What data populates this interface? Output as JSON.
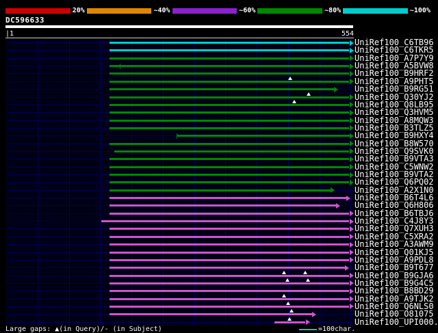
{
  "colors": {
    "cyan": "#00cccc",
    "green": "#008800",
    "magenta": "#cc55cc",
    "background": "#000000",
    "plot_background": "#000016",
    "grid": "#000066",
    "gap_marker": "#ffffff"
  },
  "query": {
    "id": "DC596633",
    "start_label": "|1",
    "end_label": "554",
    "length": 554
  },
  "legend": {
    "gaps_text": "Large gaps: ▲(in Query)/- (in Subject)",
    "scale_text": "=100char."
  },
  "chart_data": {
    "type": "bar",
    "orientation": "horizontal",
    "title": "DC596633",
    "x_range": [
      1,
      554
    ],
    "grid_interval": 50,
    "identity_key": [
      {
        "color": "#cc0000",
        "label": "20%"
      },
      {
        "color": "#dd8800",
        "label": "~40%"
      },
      {
        "color": "#8822cc",
        "label": "~60%"
      },
      {
        "color": "#008800",
        "label": "~80%"
      },
      {
        "color": "#00cccc",
        "label": "~100%"
      }
    ],
    "rows": [
      {
        "label": "UniRef100_C6TB96",
        "color": "cyan",
        "start": 165,
        "end": 548,
        "gaps": [],
        "ticks": []
      },
      {
        "label": "UniRef100_C6TKR5",
        "color": "cyan",
        "start": 165,
        "end": 548,
        "gaps": [],
        "ticks": []
      },
      {
        "label": "UniRef100_A7P7Y9",
        "color": "green",
        "start": 165,
        "end": 548,
        "gaps": [],
        "ticks": []
      },
      {
        "label": "UniRef100_A5BVW8",
        "color": "green",
        "start": 165,
        "end": 548,
        "gaps": [],
        "ticks": [
          181
        ]
      },
      {
        "label": "UniRef100_B9HRF2",
        "color": "green",
        "start": 165,
        "end": 548,
        "gaps": [],
        "ticks": []
      },
      {
        "label": "UniRef100_A9PHT5",
        "color": "green",
        "start": 165,
        "end": 548,
        "gaps": [
          453
        ],
        "ticks": []
      },
      {
        "label": "UniRef100_B9RG51",
        "color": "green",
        "start": 165,
        "end": 523,
        "gaps": [],
        "ticks": []
      },
      {
        "label": "UniRef100_Q30YJ2",
        "color": "green",
        "start": 165,
        "end": 548,
        "gaps": [
          483
        ],
        "ticks": []
      },
      {
        "label": "UniRef100_Q8LB95",
        "color": "green",
        "start": 165,
        "end": 548,
        "gaps": [
          460
        ],
        "ticks": []
      },
      {
        "label": "UniRef100_Q3HVM5",
        "color": "green",
        "start": 165,
        "end": 548,
        "gaps": [],
        "ticks": []
      },
      {
        "label": "UniRef100_A8MQW3",
        "color": "green",
        "start": 165,
        "end": 548,
        "gaps": [],
        "ticks": []
      },
      {
        "label": "UniRef100_B3TLZ5",
        "color": "green",
        "start": 165,
        "end": 548,
        "gaps": [],
        "ticks": []
      },
      {
        "label": "UniRef100_B9HXY4",
        "color": "green",
        "start": 272,
        "end": 548,
        "gaps": [],
        "ticks": [
          272
        ]
      },
      {
        "label": "UniRef100_B8W570",
        "color": "green",
        "start": 165,
        "end": 548,
        "gaps": [],
        "ticks": []
      },
      {
        "label": "UniRef100_Q9SVK0",
        "color": "green",
        "start": 173,
        "end": 548,
        "gaps": [],
        "ticks": []
      },
      {
        "label": "UniRef100_B9VTA3",
        "color": "green",
        "start": 165,
        "end": 548,
        "gaps": [],
        "ticks": []
      },
      {
        "label": "UniRef100_C5WNW2",
        "color": "green",
        "start": 165,
        "end": 548,
        "gaps": [],
        "ticks": []
      },
      {
        "label": "UniRef100_B9VTA2",
        "color": "green",
        "start": 165,
        "end": 548,
        "gaps": [],
        "ticks": []
      },
      {
        "label": "UniRef100_Q6PQ02",
        "color": "green",
        "start": 165,
        "end": 548,
        "gaps": [],
        "ticks": []
      },
      {
        "label": "UniRef100_A2X1N0",
        "color": "green",
        "start": 165,
        "end": 518,
        "gaps": [],
        "ticks": []
      },
      {
        "label": "UniRef100_B6T4L6",
        "color": "magenta",
        "start": 165,
        "end": 543,
        "gaps": [],
        "ticks": []
      },
      {
        "label": "UniRef100_Q6H806",
        "color": "magenta",
        "start": 165,
        "end": 527,
        "gaps": [],
        "ticks": []
      },
      {
        "label": "UniRef100_B6TBJ6",
        "color": "magenta",
        "start": 165,
        "end": 548,
        "gaps": [],
        "ticks": []
      },
      {
        "label": "UniRef100_C4J8Y3",
        "color": "magenta",
        "start": 152,
        "end": 548,
        "gaps": [],
        "ticks": []
      },
      {
        "label": "UniRef100_Q7XUH3",
        "color": "magenta",
        "start": 165,
        "end": 548,
        "gaps": [],
        "ticks": []
      },
      {
        "label": "UniRef100_C5XRA2",
        "color": "magenta",
        "start": 165,
        "end": 548,
        "gaps": [],
        "ticks": []
      },
      {
        "label": "UniRef100_A3AWM9",
        "color": "magenta",
        "start": 165,
        "end": 548,
        "gaps": [],
        "ticks": []
      },
      {
        "label": "UniRef100_Q01KJ5",
        "color": "magenta",
        "start": 165,
        "end": 548,
        "gaps": [],
        "ticks": []
      },
      {
        "label": "UniRef100_A9PDL8",
        "color": "magenta",
        "start": 165,
        "end": 548,
        "gaps": [],
        "ticks": []
      },
      {
        "label": "UniRef100_B9T677",
        "color": "magenta",
        "start": 165,
        "end": 541,
        "gaps": [],
        "ticks": []
      },
      {
        "label": "UniRef100_B9GJA6",
        "color": "magenta",
        "start": 165,
        "end": 548,
        "gaps": [
          444,
          477
        ],
        "ticks": []
      },
      {
        "label": "UniRef100_B9G4C5",
        "color": "magenta",
        "start": 165,
        "end": 548,
        "gaps": [
          449,
          482
        ],
        "ticks": []
      },
      {
        "label": "UniRef100_B8BD29",
        "color": "magenta",
        "start": 165,
        "end": 548,
        "gaps": [],
        "ticks": []
      },
      {
        "label": "UniRef100_A9TJK2",
        "color": "magenta",
        "start": 165,
        "end": 548,
        "gaps": [
          444
        ],
        "ticks": []
      },
      {
        "label": "UniRef100_Q6NLS0",
        "color": "magenta",
        "start": 165,
        "end": 548,
        "gaps": [
          450
        ],
        "ticks": []
      },
      {
        "label": "UniRef100_O81075",
        "color": "magenta",
        "start": 165,
        "end": 488,
        "gaps": [
          456
        ],
        "ticks": []
      },
      {
        "label": "UniRef100_UPI000...",
        "color": "magenta",
        "start": 428,
        "end": 478,
        "gaps": [
          452
        ],
        "ticks": []
      }
    ]
  }
}
